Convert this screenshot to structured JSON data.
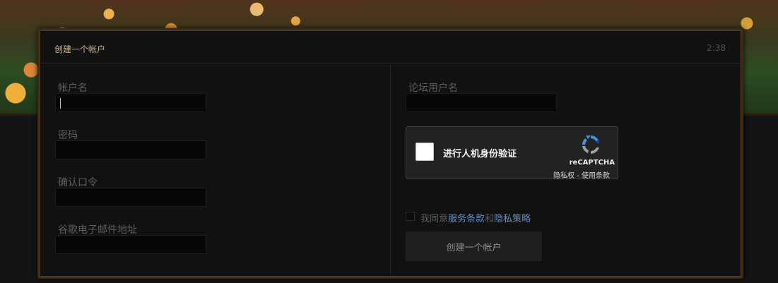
{
  "dialog": {
    "title": "创建一个帐户",
    "timer": "2:38"
  },
  "form": {
    "left": {
      "account_name_label": "帐户名",
      "password_label": "密码",
      "confirm_password_label": "确认口令",
      "google_email_label": "谷歌电子邮件地址"
    },
    "right": {
      "forum_username_label": "论坛用户名"
    }
  },
  "recaptcha": {
    "prompt": "进行人机身份验证",
    "brand": "reCAPTCHA",
    "privacy": "隐私权",
    "separator": " - ",
    "terms": "使用条款",
    "colors": {
      "blue": "#4a90e2",
      "gray": "#9aa0a6"
    }
  },
  "agreement": {
    "prefix": "我同意",
    "terms_link": "服务条款",
    "and": "和",
    "privacy_link": "隐私策略"
  },
  "submit_label": "创建一个帐户",
  "colors": {
    "accent_title": "#cdb58a",
    "link": "#6a8fbd",
    "dialog_border": "#3a2a1a"
  }
}
